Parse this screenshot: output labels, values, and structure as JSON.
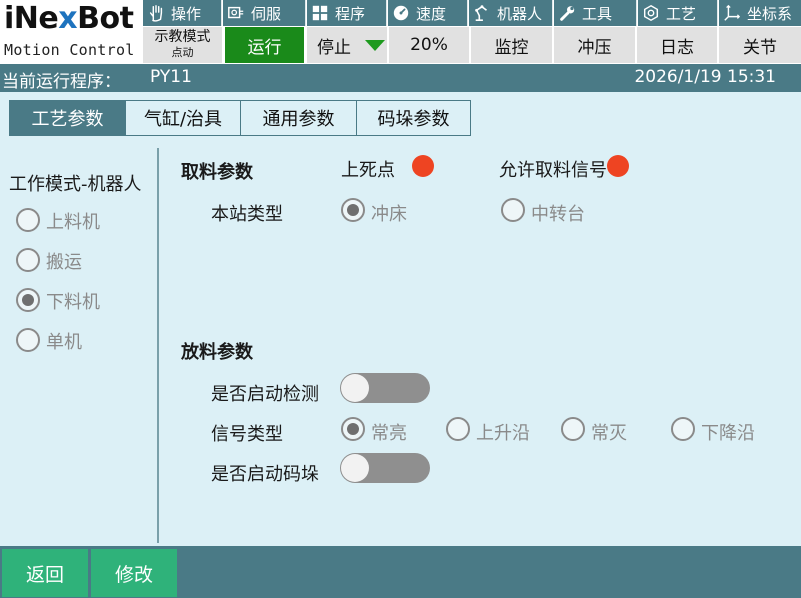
{
  "brand": {
    "name_prefix": "iNe",
    "name_x": "x",
    "name_suffix": "Bot",
    "tagline": "Motion Control"
  },
  "top_menu": [
    {
      "label": "操作",
      "icon": "hand-icon"
    },
    {
      "label": "伺服",
      "icon": "servo-icon"
    },
    {
      "label": "程序",
      "icon": "program-grid-icon"
    },
    {
      "label": "速度",
      "icon": "speedometer-icon"
    },
    {
      "label": "机器人",
      "icon": "robot-arm-icon"
    },
    {
      "label": "工具",
      "icon": "wrench-icon"
    },
    {
      "label": "工艺",
      "icon": "craft-icon"
    },
    {
      "label": "坐标系",
      "icon": "coordinate-axes-icon"
    }
  ],
  "sub_row": {
    "mode": "示教模式",
    "mode_sub": "点动",
    "run": "运行",
    "stop": "停止",
    "speed": "20%",
    "monitor": "监控",
    "press": "冲压",
    "log": "日志",
    "joint": "关节"
  },
  "status": {
    "program_label": "当前运行程序：",
    "program_name": "PY11",
    "datetime": "2026/1/19 15:31"
  },
  "tabs": [
    "工艺参数",
    "气缸/治具",
    "通用参数",
    "码垛参数"
  ],
  "left_panel": {
    "title": "工作模式-机器人",
    "options": [
      "上料机",
      "搬运",
      "下料机",
      "单机"
    ],
    "selected_index": 2
  },
  "pick": {
    "title": "取料参数",
    "top_dead_center": "上死点",
    "allow_pick_signal": "允许取料信号",
    "station_type_label": "本站类型",
    "station_options": [
      "冲床",
      "中转台"
    ],
    "station_selected_index": 0
  },
  "place": {
    "title": "放料参数",
    "enable_detect_label": "是否启动检测",
    "signal_type_label": "信号类型",
    "signal_options": [
      "常亮",
      "上升沿",
      "常灭",
      "下降沿"
    ],
    "signal_selected_index": 0,
    "enable_stack_label": "是否启动码垛"
  },
  "footer": {
    "back": "返回",
    "edit": "修改"
  },
  "colors": {
    "teal": "#4a7a86",
    "panel_bg": "#dcf0f6",
    "run_green": "#1a8a1a",
    "button_green": "#2fb27a",
    "led_red": "#ee4422"
  }
}
